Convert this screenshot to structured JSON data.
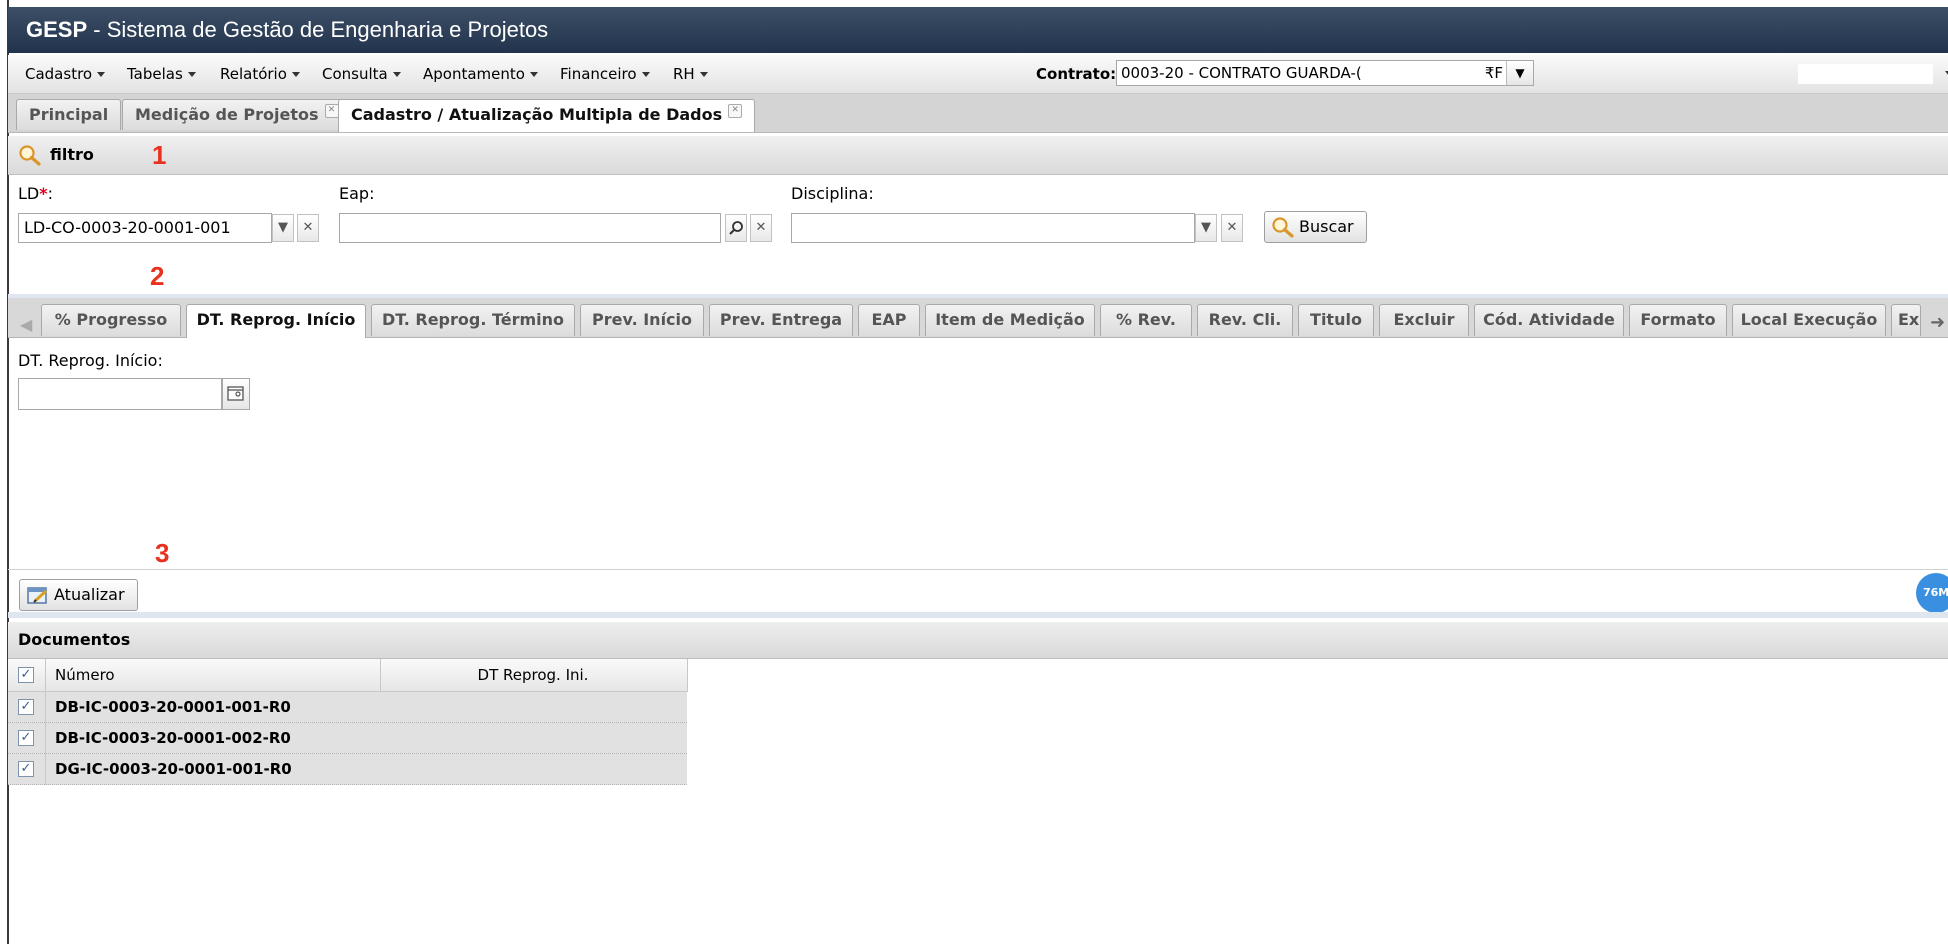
{
  "app": {
    "name": "GESP",
    "subtitle": " - Sistema de Gestão de Engenharia e Projetos"
  },
  "menu": {
    "items": [
      "Cadastro",
      "Tabelas",
      "Relatório",
      "Consulta",
      "Apontamento",
      "Financeiro",
      "RH"
    ],
    "contrato_label": "Contrato:",
    "contrato_value": "0003-20 - CONTRATO GUARDA-(",
    "contrato_tail": "₹F"
  },
  "page_tabs": [
    {
      "label": "Principal",
      "closable": false
    },
    {
      "label": "Medição de Projetos",
      "closable": true
    },
    {
      "label": "Cadastro / Atualização Multipla de Dados",
      "closable": true
    }
  ],
  "filter": {
    "title": "filtro",
    "ld_label": "LD",
    "required_mark": "*",
    "ld_colon": ":",
    "ld_value": "LD-CO-0003-20-0001-001",
    "eap_label": "Eap:",
    "eap_value": "",
    "disciplina_label": "Disciplina:",
    "disciplina_value": "",
    "buscar_label": "Buscar"
  },
  "annotations": [
    "1",
    "2",
    "3"
  ],
  "sub_tabs": [
    "% Progresso",
    "DT. Reprog. Início",
    "DT. Reprog. Término",
    "Prev. Início",
    "Prev. Entrega",
    "EAP",
    "Item de Medição",
    "% Rev.",
    "Rev. Cli.",
    "Titulo",
    "Excluir",
    "Cód. Atividade",
    "Formato",
    "Local Execução",
    "Ex"
  ],
  "active_sub_tab": "DT. Reprog. Início",
  "date_field": {
    "label": "DT. Reprog. Início:",
    "value": ""
  },
  "atualizar_label": "Atualizar",
  "badge_text": "76M",
  "documents": {
    "title": "Documentos",
    "columns": [
      "Número",
      "DT Reprog. Ini."
    ],
    "rows": [
      {
        "numero": "DB-IC-0003-20-0001-001-R0",
        "dt": "",
        "checked": true
      },
      {
        "numero": "DB-IC-0003-20-0001-002-R0",
        "dt": "",
        "checked": true
      },
      {
        "numero": "DG-IC-0003-20-0001-001-R0",
        "dt": "",
        "checked": true
      }
    ]
  },
  "colors": {
    "title_bar": "#22344d",
    "annotation_red": "#e8311e",
    "badge_blue": "#3b8fe0"
  }
}
